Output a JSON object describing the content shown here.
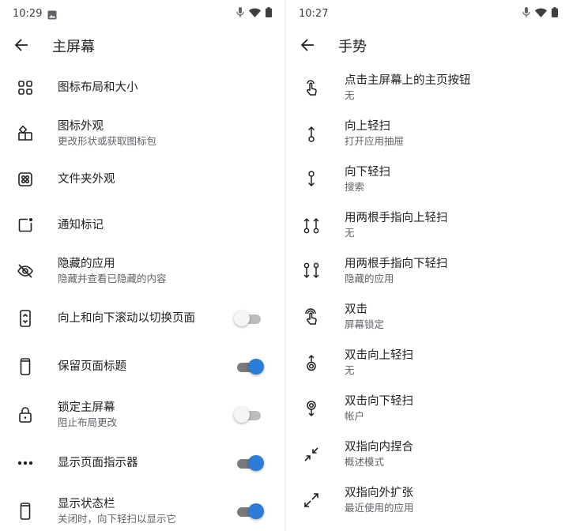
{
  "left": {
    "status": {
      "time": "10:29"
    },
    "title": "主屏幕",
    "items": [
      {
        "title": "图标布局和大小",
        "subtitle": ""
      },
      {
        "title": "图标外观",
        "subtitle": "更改形状或获取图标包"
      },
      {
        "title": "文件夹外观",
        "subtitle": ""
      },
      {
        "title": "通知标记",
        "subtitle": ""
      },
      {
        "title": "隐藏的应用",
        "subtitle": "隐藏并查看已隐藏的内容"
      },
      {
        "title": "向上和向下滚动以切换页面",
        "subtitle": "",
        "toggle": false
      },
      {
        "title": "保留页面标题",
        "subtitle": "",
        "toggle": true
      },
      {
        "title": "锁定主屏幕",
        "subtitle": "阻止布局更改",
        "toggle": false
      },
      {
        "title": "显示页面指示器",
        "subtitle": "",
        "toggle": true
      },
      {
        "title": "显示状态栏",
        "subtitle": "关闭时，向下轻扫以显示它",
        "toggle": true
      }
    ]
  },
  "right": {
    "status": {
      "time": "10:27"
    },
    "title": "手势",
    "items": [
      {
        "title": "点击主屏幕上的主页按钮",
        "subtitle": "无"
      },
      {
        "title": "向上轻扫",
        "subtitle": "打开应用抽屉"
      },
      {
        "title": "向下轻扫",
        "subtitle": "搜索"
      },
      {
        "title": "用两根手指向上轻扫",
        "subtitle": "无"
      },
      {
        "title": "用两根手指向下轻扫",
        "subtitle": "隐藏的应用"
      },
      {
        "title": "双击",
        "subtitle": "屏幕锁定"
      },
      {
        "title": "双击向上轻扫",
        "subtitle": "无"
      },
      {
        "title": "双击向下轻扫",
        "subtitle": "帐户"
      },
      {
        "title": "双指向内捏合",
        "subtitle": "概述模式"
      },
      {
        "title": "双指向外扩张",
        "subtitle": "最近使用的应用"
      }
    ]
  },
  "colors": {
    "accent": "#2f7bd8",
    "text": "#202124",
    "secondary": "#5f6368"
  },
  "icons": {
    "left": [
      "grid-icon",
      "icon-shapes-icon",
      "folder-grid-icon",
      "notification-dot-icon",
      "eye-off-icon",
      "swipe-pages-icon",
      "phone-icon",
      "lock-icon",
      "more-dots-icon",
      "phone-icon"
    ],
    "right": [
      "tap-icon",
      "swipe-up-icon",
      "swipe-down-icon",
      "two-finger-up-icon",
      "two-finger-down-icon",
      "double-tap-icon",
      "double-tap-up-icon",
      "double-tap-down-icon",
      "pinch-in-icon",
      "pinch-out-icon"
    ]
  }
}
